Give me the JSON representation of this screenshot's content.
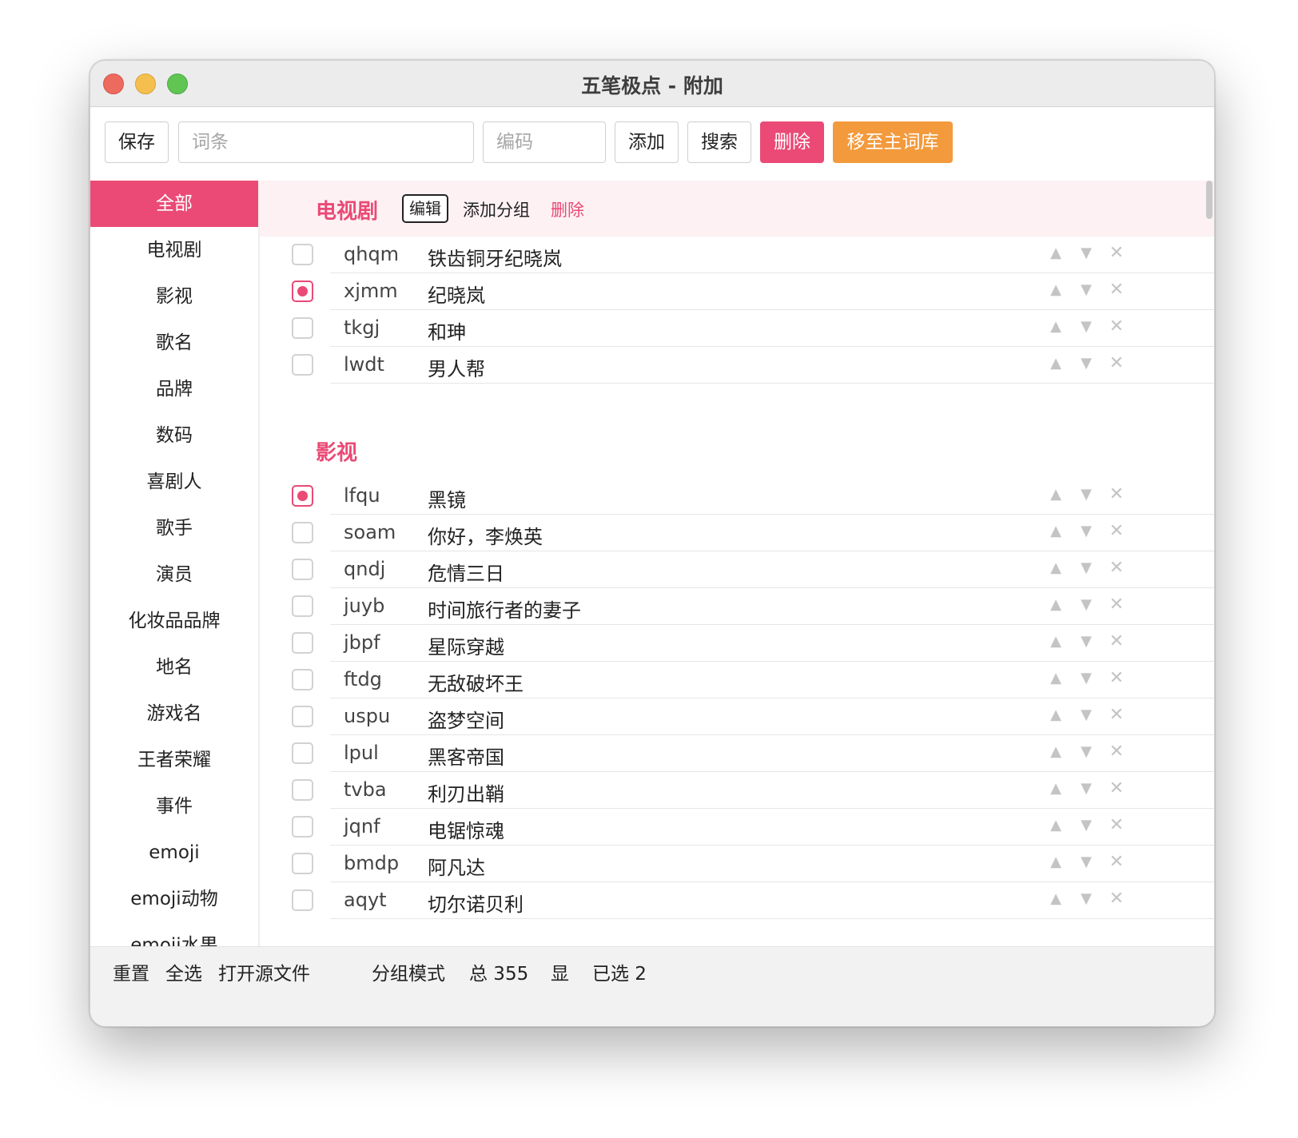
{
  "window": {
    "title": "五笔极点 - 附加"
  },
  "toolbar": {
    "save_label": "保存",
    "word_placeholder": "词条",
    "code_placeholder": "编码",
    "add_label": "添加",
    "search_label": "搜索",
    "delete_label": "删除",
    "move_label": "移至主词库"
  },
  "sidebar": {
    "items": [
      {
        "label": "全部",
        "active": true
      },
      {
        "label": "电视剧"
      },
      {
        "label": "影视"
      },
      {
        "label": "歌名"
      },
      {
        "label": "品牌"
      },
      {
        "label": "数码"
      },
      {
        "label": "喜剧人"
      },
      {
        "label": "歌手"
      },
      {
        "label": "演员"
      },
      {
        "label": "化妆品品牌"
      },
      {
        "label": "地名"
      },
      {
        "label": "游戏名"
      },
      {
        "label": "王者荣耀"
      },
      {
        "label": "事件"
      },
      {
        "label": "emoji"
      },
      {
        "label": "emoji动物"
      },
      {
        "label": "emoji水果"
      }
    ]
  },
  "main": {
    "groups": [
      {
        "title": "电视剧",
        "edit_label": "编辑",
        "add_group_label": "添加分组",
        "delete_label": "删除",
        "entries": [
          {
            "code": "qhqm",
            "word": "铁齿铜牙纪晓岚",
            "checked": false
          },
          {
            "code": "xjmm",
            "word": "纪晓岚",
            "checked": true
          },
          {
            "code": "tkgj",
            "word": "和珅",
            "checked": false
          },
          {
            "code": "lwdt",
            "word": "男人帮",
            "checked": false
          }
        ]
      },
      {
        "title": "影视",
        "entries": [
          {
            "code": "lfqu",
            "word": "黑镜",
            "checked": true
          },
          {
            "code": "soam",
            "word": "你好，李焕英",
            "checked": false
          },
          {
            "code": "qndj",
            "word": "危情三日",
            "checked": false
          },
          {
            "code": "juyb",
            "word": "时间旅行者的妻子",
            "checked": false
          },
          {
            "code": "jbpf",
            "word": "星际穿越",
            "checked": false
          },
          {
            "code": "ftdg",
            "word": "无敌破坏王",
            "checked": false
          },
          {
            "code": "uspu",
            "word": "盗梦空间",
            "checked": false
          },
          {
            "code": "lpul",
            "word": "黑客帝国",
            "checked": false
          },
          {
            "code": "tvba",
            "word": "利刃出鞘",
            "checked": false
          },
          {
            "code": "jqnf",
            "word": "电锯惊魂",
            "checked": false
          },
          {
            "code": "bmdp",
            "word": "阿凡达",
            "checked": false
          },
          {
            "code": "aqyt",
            "word": "切尔诺贝利",
            "checked": false
          }
        ]
      }
    ],
    "controls": {
      "up": "▲",
      "down": "▼",
      "remove": "✕"
    }
  },
  "statusbar": {
    "reset_label": "重置",
    "select_all_label": "全选",
    "open_source_label": "打开源文件",
    "mode_label": "分组模式",
    "total_label": "总 355",
    "shown_label": "显",
    "selected_label": "已选 2"
  },
  "colors": {
    "accent": "#ea4a75",
    "warn": "#f39a3c"
  },
  "icons": [
    "close-window-icon",
    "minimize-window-icon",
    "maximize-window-icon",
    "move-up-icon",
    "move-down-icon",
    "remove-entry-icon"
  ]
}
